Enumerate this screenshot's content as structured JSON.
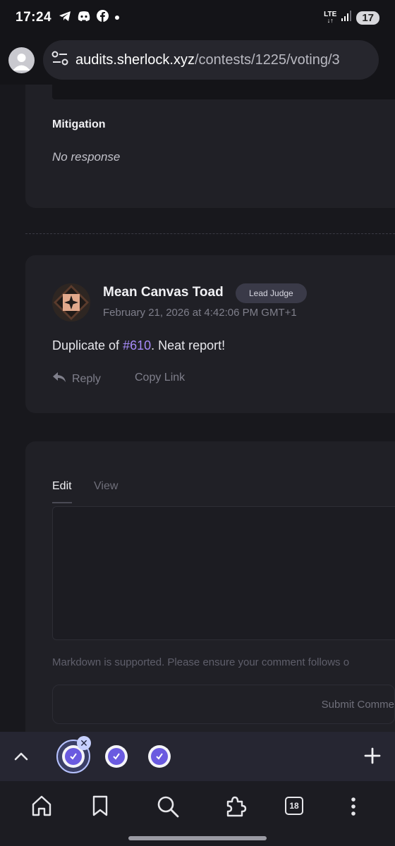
{
  "status_bar": {
    "time": "17:24",
    "network": "LTE",
    "battery": "17",
    "notification_icons": [
      "telegram-icon",
      "discord-icon",
      "facebook-icon",
      "dot-icon"
    ]
  },
  "browser": {
    "url_domain": "audits.sherlock.xyz",
    "url_path": "/contests/1225/voting/3"
  },
  "mitigation": {
    "title": "Mitigation",
    "value": "No response"
  },
  "comment": {
    "author": "Mean Canvas Toad",
    "badge": "Lead Judge",
    "date": "February 21, 2026 at 4:42:06 PM GMT+1",
    "body_prefix": "Duplicate of ",
    "body_link": "#610",
    "body_suffix": ". Neat report!",
    "reply_label": "Reply",
    "copy_link_label": "Copy Link"
  },
  "editor": {
    "tab_edit": "Edit",
    "tab_view": "View",
    "markdown_note": "Markdown is supported. Please ensure your comment follows o",
    "submit_label": "Submit Comme"
  },
  "tab_strip": {
    "tabs": [
      "sherlock-tab-1",
      "sherlock-tab-2",
      "sherlock-tab-3"
    ]
  },
  "bottom_bar": {
    "tabs_count": "18"
  },
  "colors": {
    "accent_link": "#a78bfa",
    "page_bg": "#18181d",
    "card_bg": "#202026"
  }
}
